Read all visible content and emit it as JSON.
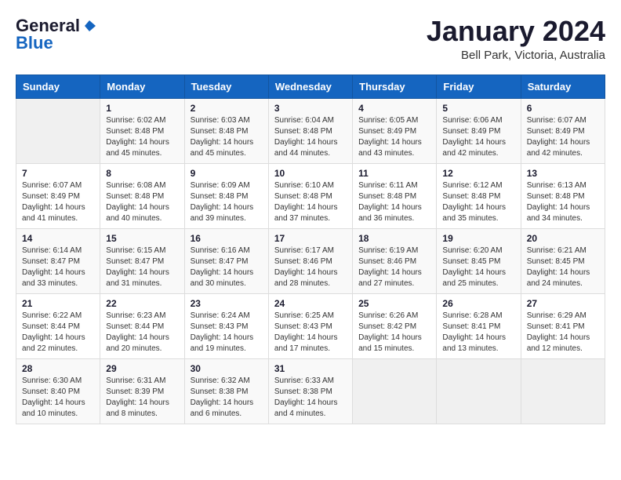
{
  "logo": {
    "text_general": "General",
    "text_blue": "Blue"
  },
  "header": {
    "title": "January 2024",
    "subtitle": "Bell Park, Victoria, Australia"
  },
  "days_of_week": [
    "Sunday",
    "Monday",
    "Tuesday",
    "Wednesday",
    "Thursday",
    "Friday",
    "Saturday"
  ],
  "weeks": [
    [
      {
        "day": "",
        "sunrise": "",
        "sunset": "",
        "daylight": ""
      },
      {
        "day": "1",
        "sunrise": "Sunrise: 6:02 AM",
        "sunset": "Sunset: 8:48 PM",
        "daylight": "Daylight: 14 hours and 45 minutes."
      },
      {
        "day": "2",
        "sunrise": "Sunrise: 6:03 AM",
        "sunset": "Sunset: 8:48 PM",
        "daylight": "Daylight: 14 hours and 45 minutes."
      },
      {
        "day": "3",
        "sunrise": "Sunrise: 6:04 AM",
        "sunset": "Sunset: 8:48 PM",
        "daylight": "Daylight: 14 hours and 44 minutes."
      },
      {
        "day": "4",
        "sunrise": "Sunrise: 6:05 AM",
        "sunset": "Sunset: 8:49 PM",
        "daylight": "Daylight: 14 hours and 43 minutes."
      },
      {
        "day": "5",
        "sunrise": "Sunrise: 6:06 AM",
        "sunset": "Sunset: 8:49 PM",
        "daylight": "Daylight: 14 hours and 42 minutes."
      },
      {
        "day": "6",
        "sunrise": "Sunrise: 6:07 AM",
        "sunset": "Sunset: 8:49 PM",
        "daylight": "Daylight: 14 hours and 42 minutes."
      }
    ],
    [
      {
        "day": "7",
        "sunrise": "Sunrise: 6:07 AM",
        "sunset": "Sunset: 8:49 PM",
        "daylight": "Daylight: 14 hours and 41 minutes."
      },
      {
        "day": "8",
        "sunrise": "Sunrise: 6:08 AM",
        "sunset": "Sunset: 8:48 PM",
        "daylight": "Daylight: 14 hours and 40 minutes."
      },
      {
        "day": "9",
        "sunrise": "Sunrise: 6:09 AM",
        "sunset": "Sunset: 8:48 PM",
        "daylight": "Daylight: 14 hours and 39 minutes."
      },
      {
        "day": "10",
        "sunrise": "Sunrise: 6:10 AM",
        "sunset": "Sunset: 8:48 PM",
        "daylight": "Daylight: 14 hours and 37 minutes."
      },
      {
        "day": "11",
        "sunrise": "Sunrise: 6:11 AM",
        "sunset": "Sunset: 8:48 PM",
        "daylight": "Daylight: 14 hours and 36 minutes."
      },
      {
        "day": "12",
        "sunrise": "Sunrise: 6:12 AM",
        "sunset": "Sunset: 8:48 PM",
        "daylight": "Daylight: 14 hours and 35 minutes."
      },
      {
        "day": "13",
        "sunrise": "Sunrise: 6:13 AM",
        "sunset": "Sunset: 8:48 PM",
        "daylight": "Daylight: 14 hours and 34 minutes."
      }
    ],
    [
      {
        "day": "14",
        "sunrise": "Sunrise: 6:14 AM",
        "sunset": "Sunset: 8:47 PM",
        "daylight": "Daylight: 14 hours and 33 minutes."
      },
      {
        "day": "15",
        "sunrise": "Sunrise: 6:15 AM",
        "sunset": "Sunset: 8:47 PM",
        "daylight": "Daylight: 14 hours and 31 minutes."
      },
      {
        "day": "16",
        "sunrise": "Sunrise: 6:16 AM",
        "sunset": "Sunset: 8:47 PM",
        "daylight": "Daylight: 14 hours and 30 minutes."
      },
      {
        "day": "17",
        "sunrise": "Sunrise: 6:17 AM",
        "sunset": "Sunset: 8:46 PM",
        "daylight": "Daylight: 14 hours and 28 minutes."
      },
      {
        "day": "18",
        "sunrise": "Sunrise: 6:19 AM",
        "sunset": "Sunset: 8:46 PM",
        "daylight": "Daylight: 14 hours and 27 minutes."
      },
      {
        "day": "19",
        "sunrise": "Sunrise: 6:20 AM",
        "sunset": "Sunset: 8:45 PM",
        "daylight": "Daylight: 14 hours and 25 minutes."
      },
      {
        "day": "20",
        "sunrise": "Sunrise: 6:21 AM",
        "sunset": "Sunset: 8:45 PM",
        "daylight": "Daylight: 14 hours and 24 minutes."
      }
    ],
    [
      {
        "day": "21",
        "sunrise": "Sunrise: 6:22 AM",
        "sunset": "Sunset: 8:44 PM",
        "daylight": "Daylight: 14 hours and 22 minutes."
      },
      {
        "day": "22",
        "sunrise": "Sunrise: 6:23 AM",
        "sunset": "Sunset: 8:44 PM",
        "daylight": "Daylight: 14 hours and 20 minutes."
      },
      {
        "day": "23",
        "sunrise": "Sunrise: 6:24 AM",
        "sunset": "Sunset: 8:43 PM",
        "daylight": "Daylight: 14 hours and 19 minutes."
      },
      {
        "day": "24",
        "sunrise": "Sunrise: 6:25 AM",
        "sunset": "Sunset: 8:43 PM",
        "daylight": "Daylight: 14 hours and 17 minutes."
      },
      {
        "day": "25",
        "sunrise": "Sunrise: 6:26 AM",
        "sunset": "Sunset: 8:42 PM",
        "daylight": "Daylight: 14 hours and 15 minutes."
      },
      {
        "day": "26",
        "sunrise": "Sunrise: 6:28 AM",
        "sunset": "Sunset: 8:41 PM",
        "daylight": "Daylight: 14 hours and 13 minutes."
      },
      {
        "day": "27",
        "sunrise": "Sunrise: 6:29 AM",
        "sunset": "Sunset: 8:41 PM",
        "daylight": "Daylight: 14 hours and 12 minutes."
      }
    ],
    [
      {
        "day": "28",
        "sunrise": "Sunrise: 6:30 AM",
        "sunset": "Sunset: 8:40 PM",
        "daylight": "Daylight: 14 hours and 10 minutes."
      },
      {
        "day": "29",
        "sunrise": "Sunrise: 6:31 AM",
        "sunset": "Sunset: 8:39 PM",
        "daylight": "Daylight: 14 hours and 8 minutes."
      },
      {
        "day": "30",
        "sunrise": "Sunrise: 6:32 AM",
        "sunset": "Sunset: 8:38 PM",
        "daylight": "Daylight: 14 hours and 6 minutes."
      },
      {
        "day": "31",
        "sunrise": "Sunrise: 6:33 AM",
        "sunset": "Sunset: 8:38 PM",
        "daylight": "Daylight: 14 hours and 4 minutes."
      },
      {
        "day": "",
        "sunrise": "",
        "sunset": "",
        "daylight": ""
      },
      {
        "day": "",
        "sunrise": "",
        "sunset": "",
        "daylight": ""
      },
      {
        "day": "",
        "sunrise": "",
        "sunset": "",
        "daylight": ""
      }
    ]
  ]
}
